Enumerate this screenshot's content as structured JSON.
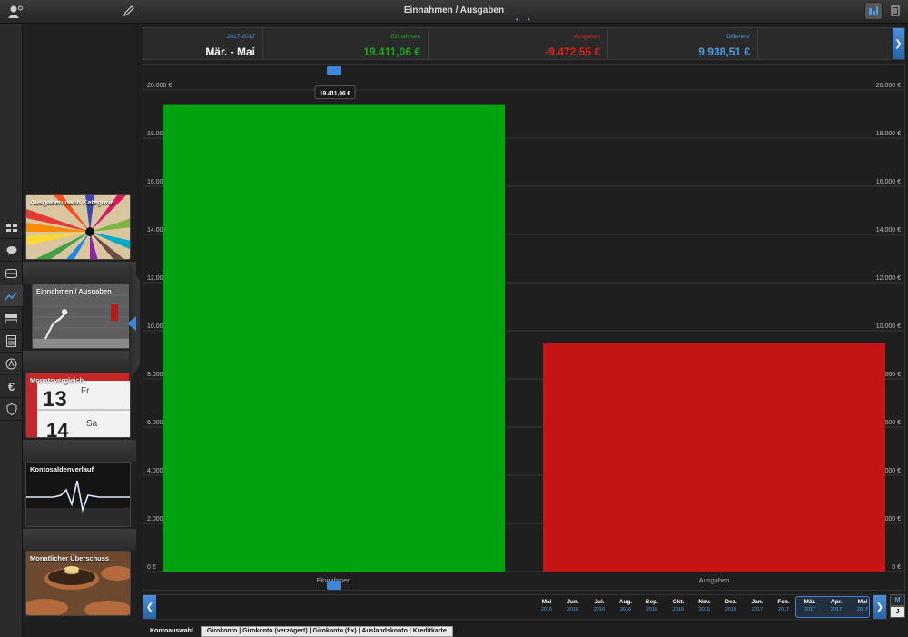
{
  "window": {
    "title": "Einnahmen / Ausgaben",
    "page_dots": "• •"
  },
  "sidebar": {
    "reports": [
      {
        "label": "Ausgaben nach Kategorie"
      },
      {
        "label": "Einnahmen / Ausgaben"
      },
      {
        "label": "Monatsvergleich"
      },
      {
        "label": "Kontosaldenverlauf"
      },
      {
        "label": "Monatlicher Überschuss"
      }
    ],
    "rail_icons": [
      "accounts-icon",
      "chat-icon",
      "card-icon",
      "chart-line-icon",
      "toggle-icon",
      "document-icon",
      "category-icon",
      "euro-icon",
      "shield-icon"
    ]
  },
  "summary": {
    "period_small": "2017-2017",
    "period_big": "Mär. - Mai",
    "income_label": "Einnahmen",
    "income_value": "19.411,06 €",
    "expense_label": "Ausgaben",
    "expense_value": "-9.472,55 €",
    "diff_label": "Differenz",
    "diff_value": "9.938,51 €",
    "colors": {
      "income": "#19a61a",
      "expense": "#e02020",
      "diff": "#4a9ee8",
      "period": "#4a9ee8"
    }
  },
  "chart_data": {
    "type": "bar",
    "categories": [
      "Einnahmen",
      "Ausgaben"
    ],
    "values": [
      19411.06,
      9472.55
    ],
    "colors": [
      "#00a30f",
      "#c41414"
    ],
    "ylim": [
      0,
      20000
    ],
    "y_ticks": [
      "0 €",
      "2.000 €",
      "4.000 €",
      "6.000 €",
      "8.000 €",
      "10.000 €",
      "12.000 €",
      "14.000 €",
      "16.000 €",
      "18.000 €",
      "20.000 €"
    ],
    "tooltip": "19.411,06 €",
    "grid": true,
    "title": "",
    "xlabel": "",
    "ylabel": ""
  },
  "timeline": {
    "months": [
      {
        "m": "Mai",
        "y": "2016"
      },
      {
        "m": "Jun.",
        "y": "2016"
      },
      {
        "m": "Jul.",
        "y": "2016"
      },
      {
        "m": "Aug.",
        "y": "2016"
      },
      {
        "m": "Sep.",
        "y": "2016"
      },
      {
        "m": "Okt.",
        "y": "2016"
      },
      {
        "m": "Nov.",
        "y": "2016"
      },
      {
        "m": "Dez.",
        "y": "2016"
      },
      {
        "m": "Jan.",
        "y": "2017"
      },
      {
        "m": "Feb.",
        "y": "2017"
      },
      {
        "m": "Mär.",
        "y": "2017"
      },
      {
        "m": "Apr.",
        "y": "2017"
      },
      {
        "m": "Mai",
        "y": "2017"
      }
    ],
    "mode_month": "M",
    "mode_year": "J"
  },
  "bottom": {
    "account_select_label": "Kontoauswahl",
    "accounts": "Girokonto | Girokonto (verzögert) | Girokonto (fix) | Auslandskonto | Kreditkarte"
  }
}
